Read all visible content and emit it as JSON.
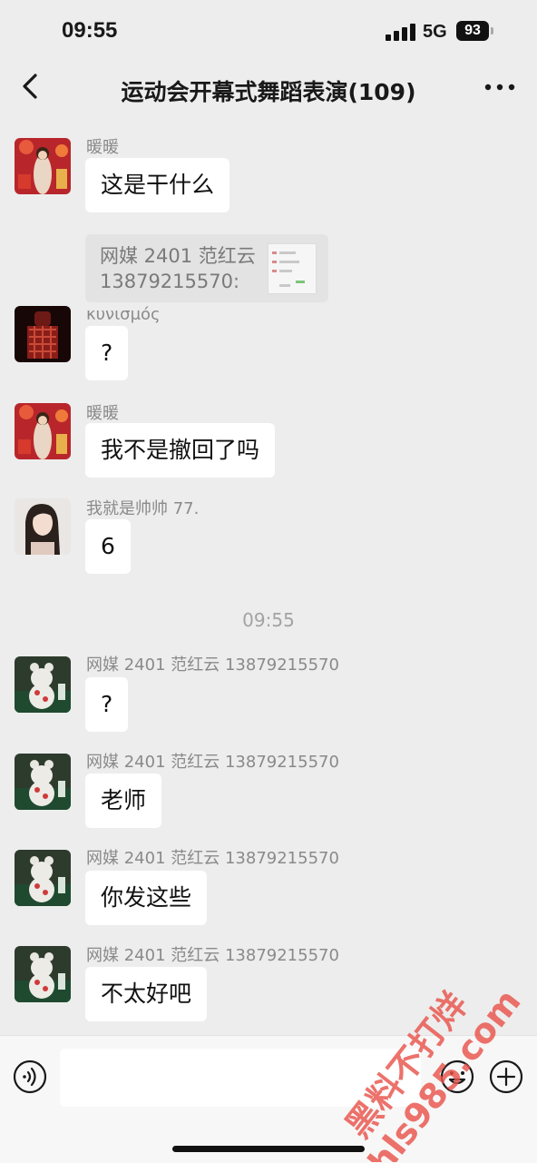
{
  "status_bar": {
    "time": "09:55",
    "network": "5G",
    "battery": "93"
  },
  "nav": {
    "title": "运动会开幕式舞蹈表演(109)"
  },
  "messages": [
    {
      "sender": "暖暖",
      "text": "这是干什么",
      "quote": {
        "line1": "网媒 2401 范红云",
        "line2": "13879215570:"
      }
    },
    {
      "sender": "κυνισμός",
      "text": "?"
    },
    {
      "sender": "暖暖",
      "text": "我不是撤回了吗"
    },
    {
      "sender": "我就是帅帅 77.",
      "text": "6"
    },
    {
      "sender": "网媒 2401 范红云 13879215570",
      "text": "?"
    },
    {
      "sender": "网媒 2401 范红云 13879215570",
      "text": "老师"
    },
    {
      "sender": "网媒 2401 范红云 13879215570",
      "text": "你发这些"
    },
    {
      "sender": "网媒 2401 范红云 13879215570",
      "text": "不太好吧"
    }
  ],
  "timestamp": "09:55",
  "input_bar": {
    "value": "",
    "placeholder": ""
  },
  "watermark": {
    "line1": "黑料不打烊",
    "line2": "hls985.com"
  },
  "colors": {
    "background": "#ededed",
    "bubble": "#ffffff",
    "quote": "#e3e3e3",
    "watermark": "#e8534a"
  },
  "icons": {
    "back": "back-chevron-icon",
    "more": "more-dots-icon",
    "voice": "voice-icon",
    "emoji": "emoji-icon",
    "plus": "plus-icon"
  }
}
